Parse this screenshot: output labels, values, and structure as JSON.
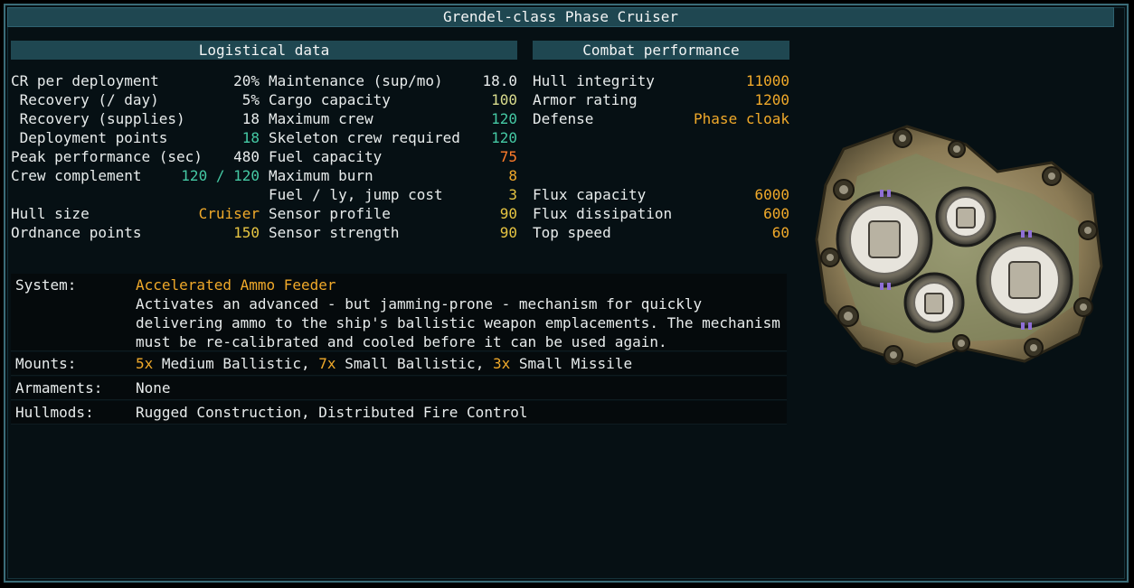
{
  "window": {
    "title": "Grendel-class Phase Cruiser"
  },
  "logistics": {
    "header": "Logistical data",
    "left": [
      {
        "label": "CR per deployment",
        "value": "20%",
        "color": "#e8ecec"
      },
      {
        "label": " Recovery (/ day)",
        "value": "5%",
        "color": "#e8ecec"
      },
      {
        "label": " Recovery (supplies)",
        "value": "18",
        "color": "#e8ecec"
      },
      {
        "label": " Deployment points",
        "value": "18",
        "color": "#45c9a4"
      },
      {
        "label": "Peak performance (sec)",
        "value": "480",
        "color": "#e8ecec"
      },
      {
        "label": "Crew complement",
        "value": "120 / 120",
        "color": "#45c9a4"
      },
      {
        "label": "",
        "value": "",
        "color": "#e8ecec"
      },
      {
        "label": "Hull size",
        "value": "Cruiser",
        "color": "#f0a92a"
      },
      {
        "label": "Ordnance points",
        "value": "150",
        "color": "#e7c542"
      }
    ],
    "right": [
      {
        "label": "Maintenance (sup/mo)",
        "value": "18.0",
        "color": "#e8ecec"
      },
      {
        "label": "Cargo capacity",
        "value": "100",
        "color": "#d9dc8e"
      },
      {
        "label": "Maximum crew",
        "value": "120",
        "color": "#45c9a4"
      },
      {
        "label": "Skeleton crew required",
        "value": "120",
        "color": "#45c9a4"
      },
      {
        "label": "Fuel capacity",
        "value": "75",
        "color": "#ff7c2a"
      },
      {
        "label": "Maximum burn",
        "value": "8",
        "color": "#f0a92a"
      },
      {
        "label": "Fuel / ly, jump cost",
        "value": "3",
        "color": "#e7c542"
      },
      {
        "label": "Sensor profile",
        "value": "90",
        "color": "#e7c542"
      },
      {
        "label": "Sensor strength",
        "value": "90",
        "color": "#e7c542"
      }
    ]
  },
  "combat": {
    "header": "Combat performance",
    "rows": [
      {
        "label": "Hull integrity",
        "value": "11000",
        "color": "#f0a92a"
      },
      {
        "label": "Armor rating",
        "value": "1200",
        "color": "#f0a92a"
      },
      {
        "label": "Defense",
        "value": "Phase cloak",
        "color": "#f0a92a"
      },
      {
        "label": "",
        "value": "",
        "color": "#e8ecec"
      },
      {
        "label": "",
        "value": "",
        "color": "#e8ecec"
      },
      {
        "label": "",
        "value": "",
        "color": "#e8ecec"
      },
      {
        "label": "Flux capacity",
        "value": "6000",
        "color": "#f0a92a"
      },
      {
        "label": "Flux dissipation",
        "value": "600",
        "color": "#f0a92a"
      },
      {
        "label": "Top speed",
        "value": "60",
        "color": "#f0a92a"
      }
    ]
  },
  "details": {
    "system_label": "System:",
    "system_name": "Accelerated Ammo Feeder",
    "system_desc": "Activates an advanced - but jamming-prone - mechanism for quickly delivering ammo to the ship's ballistic weapon emplacements. The mechanism must be re-calibrated and cooled before it can be used again.",
    "mounts_label": "Mounts:",
    "mounts": [
      {
        "count": "5x",
        "type": " Medium Ballistic, "
      },
      {
        "count": "7x",
        "type": " Small Ballistic, "
      },
      {
        "count": "3x",
        "type": " Small Missile"
      }
    ],
    "armaments_label": "Armaments:",
    "armaments": "None",
    "hullmods_label": "Hullmods:",
    "hullmods": "Rugged Construction, Distributed Fire Control"
  },
  "ship_image": {
    "icon": "ship-sprite-icon"
  }
}
